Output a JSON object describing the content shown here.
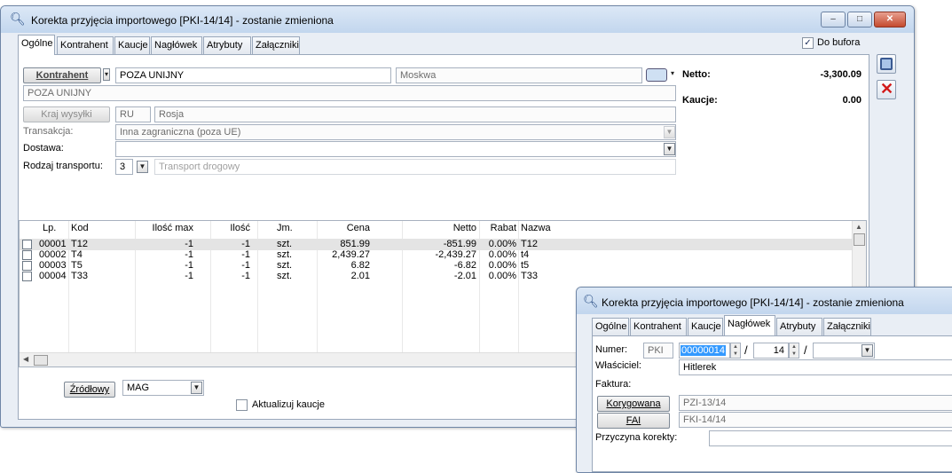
{
  "main_window": {
    "title": "Korekta przyjęcia importowego [PKI-14/14]  - zostanie zmieniona",
    "tabs": [
      "Ogólne",
      "Kontrahent",
      "Kaucje",
      "Nagłówek",
      "Atrybuty",
      "Załączniki"
    ],
    "active_tab": "Ogólne",
    "do_bufora_label": "Do bufora",
    "do_bufora_checked": true,
    "kontrahent_button": "Kontrahent",
    "kontrahent_code": "POZA UNIJNY",
    "kontrahent_city": "Moskwa",
    "kontrahent_name": "POZA UNIJNY",
    "kraj_wysylki_button": "Kraj wysyłki",
    "kraj_code": "RU",
    "kraj_name": "Rosja",
    "transakcja_label": "Transakcja:",
    "transakcja_value": "Inna zagraniczna (poza UE)",
    "dostawa_label": "Dostawa:",
    "dostawa_value": "",
    "rodzaj_transportu_label": "Rodzaj transportu:",
    "rodzaj_transportu_code": "3",
    "rodzaj_transportu_name": "Transport drogowy",
    "netto_label": "Netto:",
    "netto_value": "-3,300.09",
    "kaucje_label": "Kaucje:",
    "kaucje_value": "0.00",
    "grid": {
      "headers": [
        "Lp.",
        "Kod",
        "Ilość max",
        "Ilość",
        "Jm.",
        "Cena",
        "Netto",
        "Rabat",
        "Nazwa"
      ],
      "rows": [
        {
          "lp": "00001",
          "kod": "T12",
          "ilosc_max": "-1",
          "ilosc": "-1",
          "jm": "szt.",
          "cena": "851.99",
          "netto": "-851.99",
          "rabat": "0.00%",
          "nazwa": "T12"
        },
        {
          "lp": "00002",
          "kod": "T4",
          "ilosc_max": "-1",
          "ilosc": "-1",
          "jm": "szt.",
          "cena": "2,439.27",
          "netto": "-2,439.27",
          "rabat": "0.00%",
          "nazwa": "t4"
        },
        {
          "lp": "00003",
          "kod": "T5",
          "ilosc_max": "-1",
          "ilosc": "-1",
          "jm": "szt.",
          "cena": "6.82",
          "netto": "-6.82",
          "rabat": "0.00%",
          "nazwa": "t5"
        },
        {
          "lp": "00004",
          "kod": "T33",
          "ilosc_max": "-1",
          "ilosc": "-1",
          "jm": "szt.",
          "cena": "2.01",
          "netto": "-2.01",
          "rabat": "0.00%",
          "nazwa": "T33"
        }
      ]
    },
    "zrodlowy_button": "Źródłowy",
    "magazyn_value": "MAG",
    "aktualizuj_kaucje_label": "Aktualizuj kaucje",
    "aktualizuj_kaucje_checked": false
  },
  "second_window": {
    "title": "Korekta przyjęcia importowego [PKI-14/14]  - zostanie zmieniona",
    "tabs": [
      "Ogólne",
      "Kontrahent",
      "Kaucje",
      "Nagłówek",
      "Atrybuty",
      "Załączniki"
    ],
    "active_tab": "Nagłówek",
    "numer_label": "Numer:",
    "numer_prefix": "PKI",
    "numer_value": "00000014",
    "numer_separator": "/",
    "numer_year": "14",
    "wlasciciel_label": "Właściciel:",
    "wlasciciel_value": "Hitlerek",
    "faktura_label": "Faktura:",
    "korygowana_button": "Korygowana",
    "korygowana_value": "PZI-13/14",
    "fai_button": "FAI",
    "fai_value": "FKI-14/14",
    "przyczyna_label": "Przyczyna korekty:",
    "przyczyna_value": ""
  },
  "colors": {
    "selection": "#3399ff",
    "titlebar": "#c2d6ee",
    "close_button": "#c44a2e"
  }
}
